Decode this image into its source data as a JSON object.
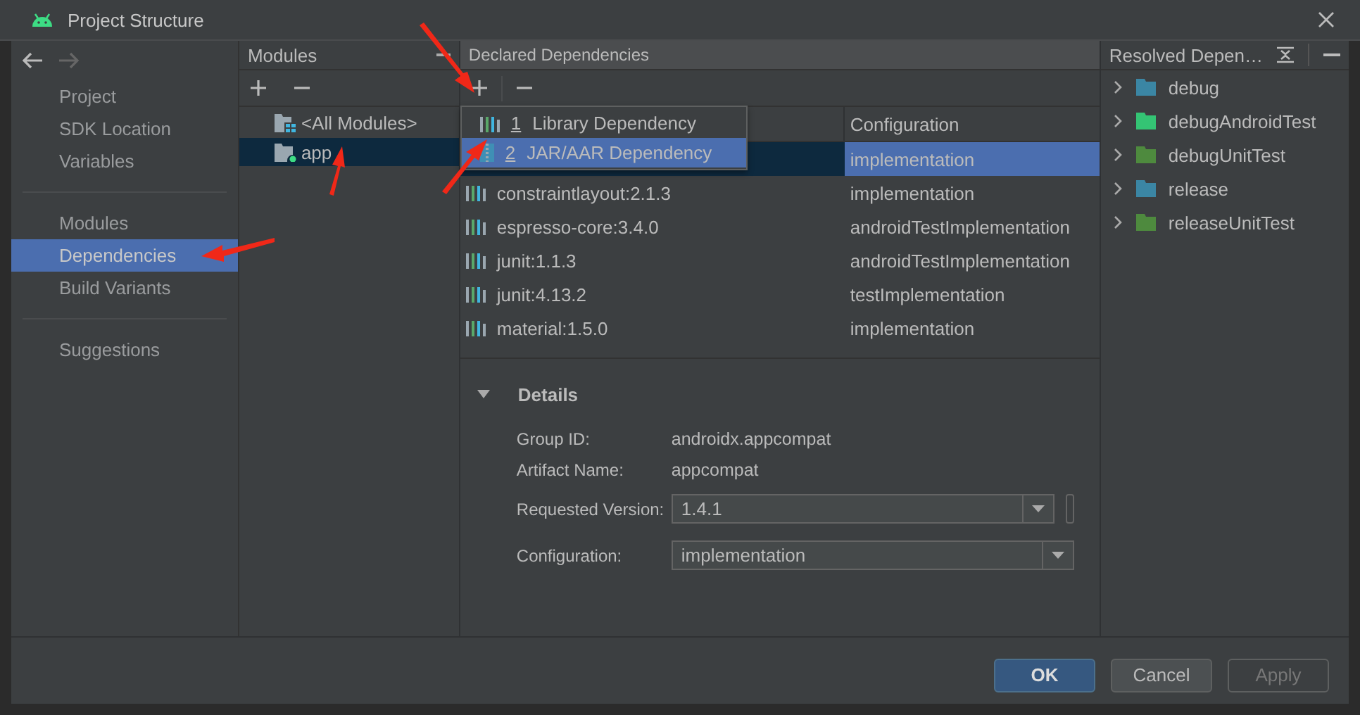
{
  "window": {
    "title": "Project Structure"
  },
  "sidebar": {
    "groups": [
      {
        "items": [
          {
            "label": "Project",
            "selected": false
          },
          {
            "label": "SDK Location",
            "selected": false
          },
          {
            "label": "Variables",
            "selected": false
          }
        ]
      },
      {
        "items": [
          {
            "label": "Modules",
            "selected": false
          },
          {
            "label": "Dependencies",
            "selected": true
          },
          {
            "label": "Build Variants",
            "selected": false
          }
        ]
      },
      {
        "items": [
          {
            "label": "Suggestions",
            "selected": false
          }
        ]
      }
    ]
  },
  "modules": {
    "title": "Modules",
    "items": [
      {
        "label": "<All Modules>",
        "kind": "all",
        "selected": false
      },
      {
        "label": "app",
        "kind": "module",
        "selected": true
      }
    ]
  },
  "declared": {
    "title": "Declared Dependencies",
    "configuration_column": "Configuration",
    "rows": [
      {
        "configuration": "implementation",
        "selected": true
      },
      {
        "name": "constraintlayout:2.1.3",
        "configuration": "implementation",
        "selected": false
      },
      {
        "name": "espresso-core:3.4.0",
        "configuration": "androidTestImplementation",
        "selected": false
      },
      {
        "name": "junit:1.1.3",
        "configuration": "androidTestImplementation",
        "selected": false
      },
      {
        "name": "junit:4.13.2",
        "configuration": "testImplementation",
        "selected": false
      },
      {
        "name": "material:1.5.0",
        "configuration": "implementation",
        "selected": false
      }
    ],
    "add_menu": {
      "items": [
        {
          "number": "1",
          "label": "Library Dependency",
          "kind": "library",
          "selected": false
        },
        {
          "number": "2",
          "label": "JAR/AAR Dependency",
          "kind": "jar",
          "selected": true
        }
      ]
    },
    "details": {
      "title": "Details",
      "expanded": true,
      "fields": [
        {
          "label": "Group ID:",
          "value": "androidx.appcompat",
          "kind": "text"
        },
        {
          "label": "Artifact Name:",
          "value": "appcompat",
          "kind": "text"
        },
        {
          "label": "Requested Version:",
          "value": "1.4.1",
          "kind": "combo-extra"
        },
        {
          "label": "Configuration:",
          "value": "implementation",
          "kind": "combo"
        }
      ]
    }
  },
  "resolved": {
    "title": "Resolved Depen…",
    "items": [
      {
        "label": "debug",
        "color": "#3b86a4",
        "expanded": false
      },
      {
        "label": "debugAndroidTest",
        "color": "#34c474",
        "expanded": false
      },
      {
        "label": "debugUnitTest",
        "color": "#4e8a3e",
        "expanded": false
      },
      {
        "label": "release",
        "color": "#3b86a4",
        "expanded": false
      },
      {
        "label": "releaseUnitTest",
        "color": "#4e8a3e",
        "expanded": false
      }
    ]
  },
  "buttons": [
    {
      "label": "OK",
      "kind": "default",
      "disabled": false
    },
    {
      "label": "Cancel",
      "kind": "normal",
      "disabled": false
    },
    {
      "label": "Apply",
      "kind": "normal",
      "disabled": true
    }
  ]
}
